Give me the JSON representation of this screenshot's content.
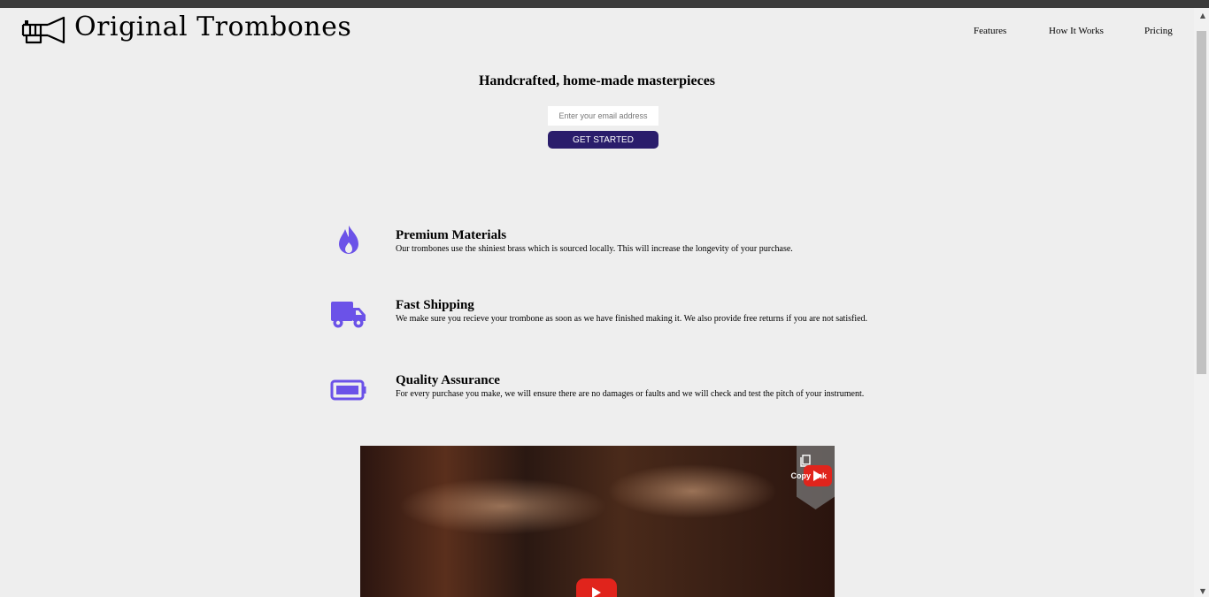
{
  "brand": {
    "name": "Original Trombones",
    "logo_icon": "trombone-icon"
  },
  "nav": [
    {
      "label": "Features"
    },
    {
      "label": "How It Works"
    },
    {
      "label": "Pricing"
    }
  ],
  "hero": {
    "title": "Handcrafted, home-made masterpieces",
    "email_placeholder": "Enter your email address",
    "cta_label": "GET STARTED"
  },
  "features": [
    {
      "icon": "flame-icon",
      "title": "Premium Materials",
      "description": "Our trombones use the shiniest brass which is sourced locally. This will increase the longevity of your purchase."
    },
    {
      "icon": "truck-icon",
      "title": "Fast Shipping",
      "description": "We make sure you recieve your trombone as soon as we have finished making it. We also provide free returns if you are not satisfied."
    },
    {
      "icon": "battery-icon",
      "title": "Quality Assurance",
      "description": "For every purchase you make, we will ensure there are no damages or faults and we will check and test the pitch of your instrument."
    }
  ],
  "video": {
    "share_label": "Copy link"
  },
  "colors": {
    "accent": "#6b52e8",
    "button": "#2a1d6b",
    "background": "#eeeeee"
  }
}
